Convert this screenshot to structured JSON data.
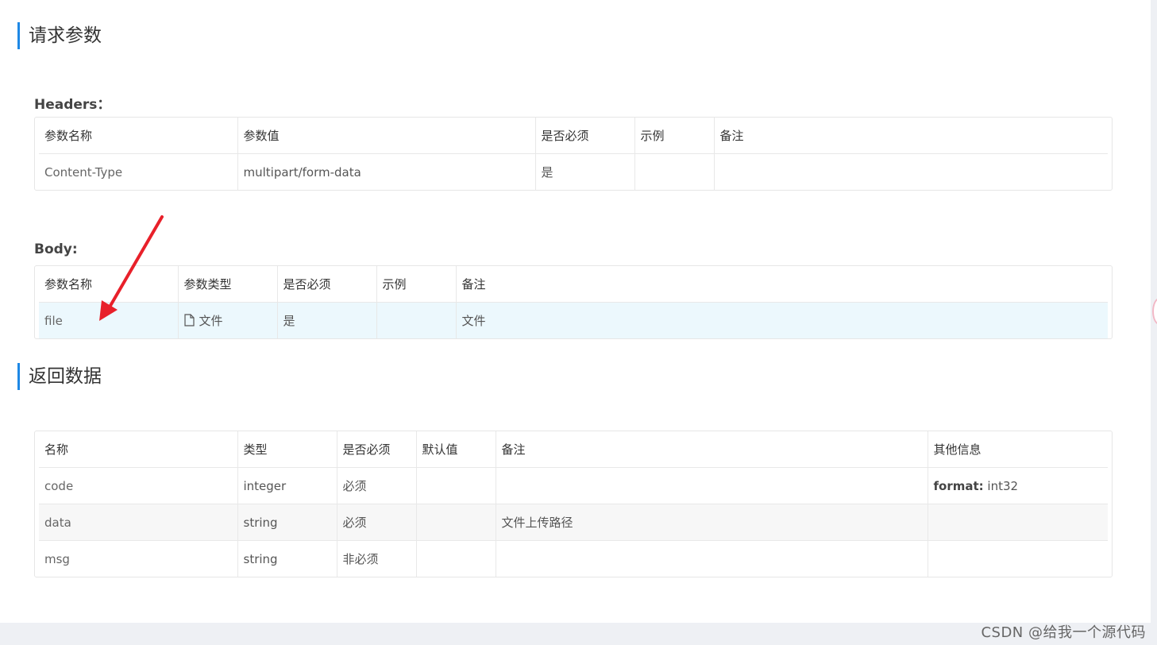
{
  "request_section": {
    "title": "请求参数"
  },
  "headers": {
    "label": "Headers：",
    "columns": [
      "参数名称",
      "参数值",
      "是否必须",
      "示例",
      "备注"
    ],
    "rows": [
      {
        "name": "Content-Type",
        "value": "multipart/form-data",
        "required": "是",
        "example": "",
        "note": ""
      }
    ]
  },
  "body": {
    "label": "Body:",
    "columns": [
      "参数名称",
      "参数类型",
      "是否必须",
      "示例",
      "备注"
    ],
    "rows": [
      {
        "name": "file",
        "type": "文件",
        "type_icon": "file-icon",
        "required": "是",
        "example": "",
        "note": "文件"
      }
    ]
  },
  "response_section": {
    "title": "返回数据"
  },
  "response": {
    "columns": [
      "名称",
      "类型",
      "是否必须",
      "默认值",
      "备注",
      "其他信息"
    ],
    "rows": [
      {
        "name": "code",
        "type": "integer",
        "required": "必须",
        "default": "",
        "note": "",
        "extra_key": "format:",
        "extra_value": " int32"
      },
      {
        "name": "data",
        "type": "string",
        "required": "必须",
        "default": "",
        "note": "文件上传路径",
        "extra_key": "",
        "extra_value": ""
      },
      {
        "name": "msg",
        "type": "string",
        "required": "非必须",
        "default": "",
        "note": "",
        "extra_key": "",
        "extra_value": ""
      }
    ]
  },
  "watermark": "CSDN @给我一个源代码",
  "colors": {
    "accent": "#1e88e5",
    "highlight_row": "#ecf8fd",
    "arrow": "#e8202a"
  }
}
